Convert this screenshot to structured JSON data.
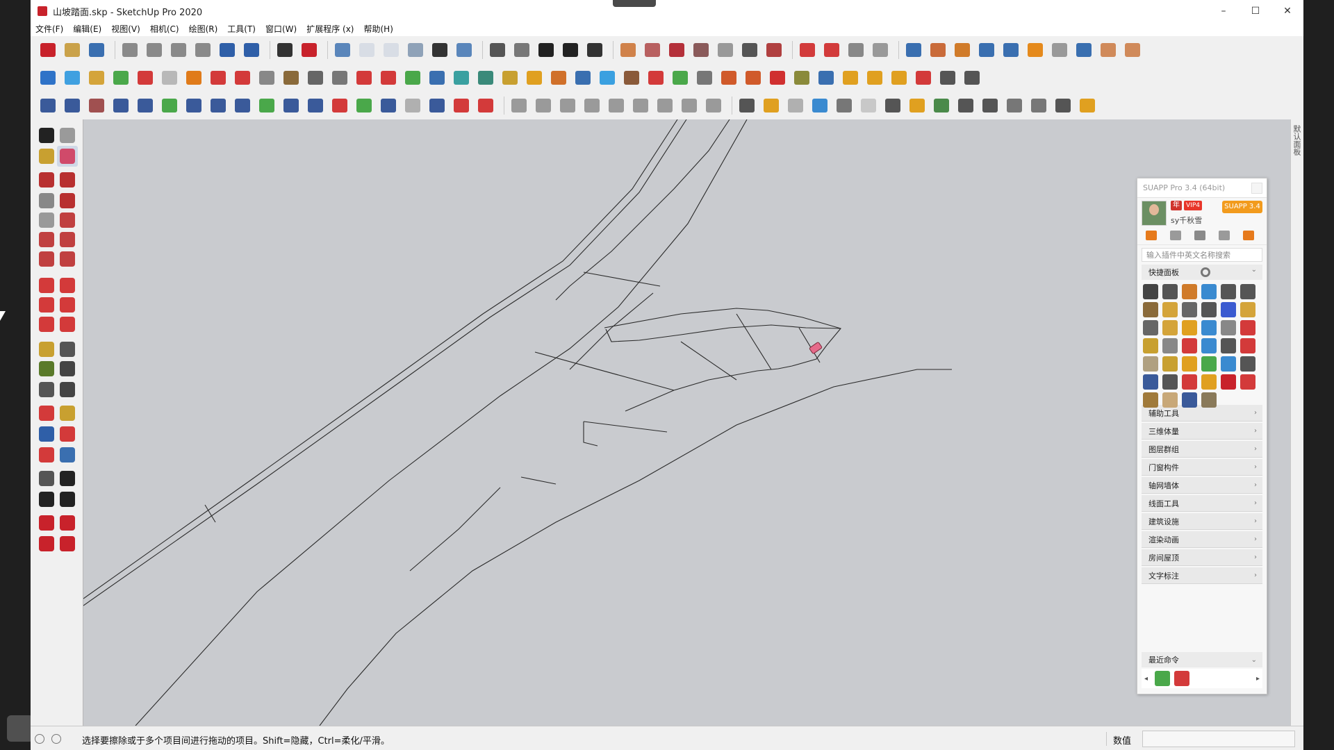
{
  "window": {
    "title": "山坡踏面.skp - SketchUp Pro 2020",
    "minimize": "–",
    "maximize": "☐",
    "close": "✕"
  },
  "menu": [
    "文件(F)",
    "编辑(E)",
    "视图(V)",
    "相机(C)",
    "绘图(R)",
    "工具(T)",
    "窗口(W)",
    "扩展程序 (x)",
    "帮助(H)"
  ],
  "toolbar_colors": {
    "row1": [
      "#c8222b",
      "#caa24a",
      "#3a6fb0",
      "#8a8a8a",
      "#8a8a8a",
      "#8a8a8a",
      "#8a8a8a",
      "#2f5fa8",
      "#2f5fa8",
      "#333333",
      "#c8222b",
      "#5a86bb",
      "#d8dde5",
      "#d8dde5",
      "#8fa2b8",
      "#333333",
      "#5a86bb",
      "#555555",
      "#777777",
      "#222222",
      "#222222",
      "#333333",
      "#d0824a",
      "#b86060",
      "#b4303a",
      "#8a5a5a",
      "#999999",
      "#555555",
      "#b04040",
      "#d23b3b",
      "#d23b3b",
      "#888888",
      "#999999",
      "#3a6fb0",
      "#c96b3a",
      "#d07b2a",
      "#3a6fb0",
      "#3a6fb0",
      "#e58a1c",
      "#999999",
      "#3a6fb0",
      "#d08a5a",
      "#d08a5a"
    ],
    "row2": [
      "#2f73c8",
      "#3fa0e0",
      "#d4a43a",
      "#4aa84a",
      "#d33a3a",
      "#b8b8b8",
      "#e07b1a",
      "#d33a3a",
      "#d33a3a",
      "#888888",
      "#8a6a3a",
      "#666666",
      "#777777",
      "#d33a3a",
      "#d33a3a",
      "#4aa84a",
      "#3a6fb0",
      "#3aa0a0",
      "#3a8a7a",
      "#c8a030",
      "#e0a020",
      "#d0702a",
      "#3a6fb0",
      "#3aa0e0",
      "#8a5a3a",
      "#d33a3a",
      "#4aa84a",
      "#777777",
      "#d05a2a",
      "#d05a2a",
      "#d03030",
      "#8a8a3a",
      "#3a6fb0",
      "#e0a020",
      "#e0a020",
      "#e0a020",
      "#d33a3a",
      "#555555",
      "#555555"
    ],
    "row3": [
      "#3a5a9a",
      "#3a5a9a",
      "#a05050",
      "#3a5a9a",
      "#3a5a9a",
      "#4aa84a",
      "#3a5a9a",
      "#3a5a9a",
      "#3a5a9a",
      "#4aa84a",
      "#3a5a9a",
      "#3a5a9a",
      "#d33a3a",
      "#4aa84a",
      "#3a5a9a",
      "#b0b0b0",
      "#3a5a9a",
      "#d33a3a",
      "#d33a3a",
      "#9a9a9a",
      "#9a9a9a",
      "#9a9a9a",
      "#9a9a9a",
      "#9a9a9a",
      "#9a9a9a",
      "#9a9a9a",
      "#9a9a9a",
      "#9a9a9a",
      "#555555",
      "#e0a020",
      "#b0b0b0",
      "#3a8ad0",
      "#777777",
      "#c8c8c8",
      "#555555",
      "#e0a020",
      "#4a8a4a",
      "#555555",
      "#555555",
      "#777777",
      "#777777",
      "#555555",
      "#e0a020"
    ]
  },
  "left_tools_colors": [
    "#222222",
    "#9a9a9a",
    "#c8a030",
    "#d04a6a",
    "#b83030",
    "#b83030",
    "#888888",
    "#b83030",
    "#999999",
    "#c04040",
    "#c04040",
    "#c04040",
    "#c04040",
    "#c04040",
    "#d33a3a",
    "#d33a3a",
    "#d33a3a",
    "#d33a3a",
    "#d33a3a",
    "#d33a3a",
    "#c8a030",
    "#555555",
    "#5a7a2a",
    "#444444",
    "#555555",
    "#444444",
    "#d33a3a",
    "#c8a030",
    "#2f5fa8",
    "#d33a3a",
    "#d33a3a",
    "#3a6fb0",
    "#555555",
    "#222222",
    "#222222",
    "#222222",
    "#c8222b",
    "#c8222b",
    "#c8222b",
    "#c8222b"
  ],
  "suapp": {
    "title": "SUAPP Pro 3.4 (64bit)",
    "badge1": "年",
    "badge_vip": "VIP4",
    "version_badge": "SUAPP 3.4",
    "username": "sy千秋雪",
    "search_placeholder": "输入插件中英文名称搜索",
    "quick_panel": "快捷面板",
    "grid_colors": [
      "#444444",
      "#555555",
      "#d07b2a",
      "#3a8ad0",
      "#555555",
      "#555555",
      "#8a6a3a",
      "#d4a43a",
      "#666666",
      "#555555",
      "#3a5ad0",
      "#d4a43a",
      "#666666",
      "#d4a43a",
      "#e0a020",
      "#3a8ad0",
      "#888888",
      "#d33a3a",
      "#c8a030",
      "#888888",
      "#d33a3a",
      "#3a8ad0",
      "#555555",
      "#d33a3a",
      "#b0a080",
      "#c8a030",
      "#e0a020",
      "#4aa84a",
      "#3a8ad0",
      "#555555",
      "#3a5a9a",
      "#555555",
      "#d33a3a",
      "#e0a020",
      "#c8222b",
      "#d33a3a",
      "#a07a3a",
      "#c8a878",
      "#3a5a9a",
      "#8a7a5a"
    ],
    "categories": [
      "辅助工具",
      "三维体量",
      "图层群组",
      "门窗构件",
      "轴网墙体",
      "线面工具",
      "建筑设施",
      "渲染动画",
      "房间屋顶",
      "文字标注"
    ],
    "recent": "最近命令",
    "chevron_right": "›",
    "chevron_down": "⌄",
    "scroll_left": "◂",
    "scroll_right": "▸"
  },
  "status": {
    "text": "选择要擦除或于多个项目间进行拖动的项目。Shift=隐藏，Ctrl=柔化/平滑。",
    "value_label": "数值"
  },
  "right_tab_label": "默认面板"
}
